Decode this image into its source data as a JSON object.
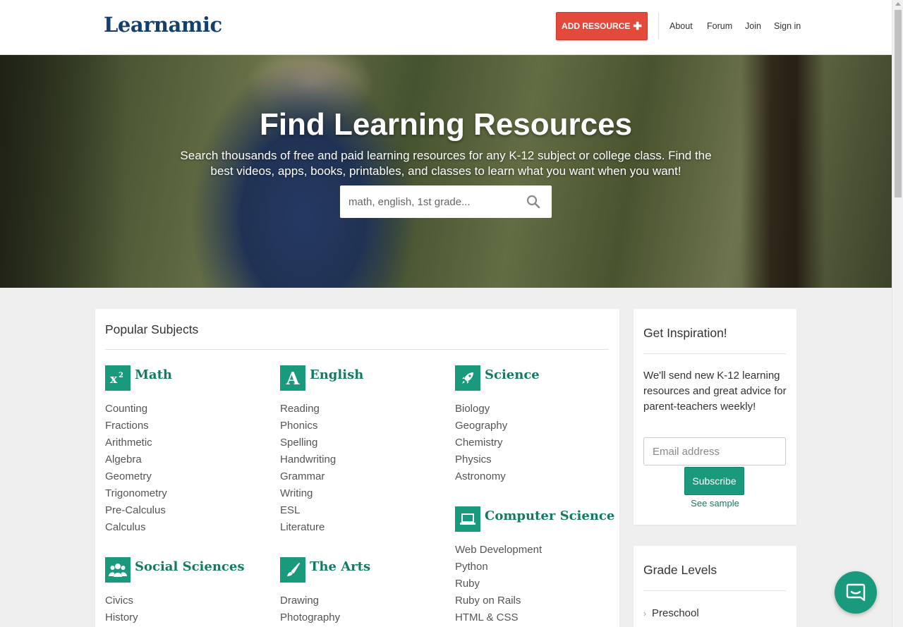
{
  "header": {
    "logo": "Learnamic",
    "add_resource_label": "ADD RESOURCE",
    "add_resource_icon": "plus-icon",
    "nav": [
      {
        "label": "About"
      },
      {
        "label": "Forum"
      },
      {
        "label": "Join"
      },
      {
        "label": "Sign in"
      }
    ]
  },
  "hero": {
    "title": "Find Learning Resources",
    "subtitle": "Search thousands of free and paid learning resources for any K-12 subject or college class. Find the best videos, apps, books, printables, and classes to learn what you want when you want!",
    "search_placeholder": "math, english, 1st grade...",
    "search_icon": "search-icon"
  },
  "subjects": {
    "title": "Popular Subjects",
    "math": {
      "name": "Math",
      "icon": "superscript-x2-icon",
      "items": [
        "Counting",
        "Fractions",
        "Arithmetic",
        "Algebra",
        "Geometry",
        "Trigonometry",
        "Pre-Calculus",
        "Calculus"
      ]
    },
    "english": {
      "name": "English",
      "icon": "letter-a-icon",
      "items": [
        "Reading",
        "Phonics",
        "Spelling",
        "Handwriting",
        "Grammar",
        "Writing",
        "ESL",
        "Literature"
      ]
    },
    "science": {
      "name": "Science",
      "icon": "rocket-icon",
      "items": [
        "Biology",
        "Geography",
        "Chemistry",
        "Physics",
        "Astronomy"
      ]
    },
    "cs": {
      "name": "Computer Science",
      "icon": "laptop-icon",
      "items": [
        "Web Development",
        "Python",
        "Ruby",
        "Ruby on Rails",
        "HTML & CSS"
      ]
    },
    "social": {
      "name": "Social Sciences",
      "icon": "people-icon",
      "items": [
        "Civics",
        "History"
      ]
    },
    "arts": {
      "name": "The Arts",
      "icon": "paintbrush-icon",
      "items": [
        "Drawing",
        "Photography"
      ]
    }
  },
  "inspiration": {
    "title": "Get Inspiration!",
    "text": "We'll send new K-12 learning resources and great advice for parent-teachers weekly!",
    "email_placeholder": "Email address",
    "subscribe_label": "Subscribe",
    "see_sample": "See sample"
  },
  "grades": {
    "title": "Grade Levels",
    "items": [
      "Preschool"
    ]
  },
  "colors": {
    "brand_navy": "#15406b",
    "accent_green": "#1a9a7c",
    "add_button_red": "#e44a3c"
  },
  "chat_icon": "chat-bubble-icon"
}
